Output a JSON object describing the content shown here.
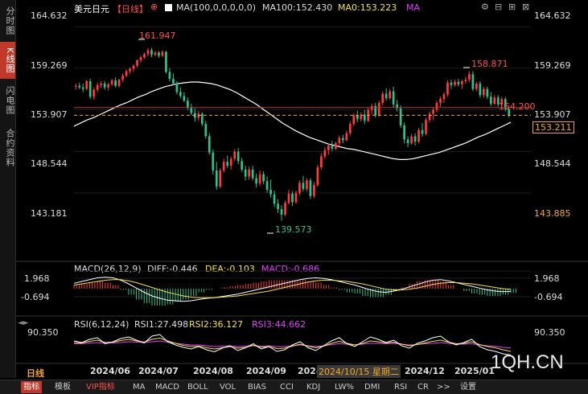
{
  "sidebar": {
    "tabs": [
      {
        "label": "分时图",
        "active": false
      },
      {
        "label": "K线图",
        "active": true
      },
      {
        "label": "闪电图",
        "active": false
      },
      {
        "label": "合约资料",
        "active": false
      }
    ]
  },
  "legend": {
    "symbol": "美元日元",
    "period": "【日线】",
    "ma_prefix": "MA(100,0,0,0,0,0)",
    "ma100": "MA100:152.430",
    "ma0": "MA0:153.223",
    "ma": "MA"
  },
  "toolbar_icons": [
    "gear-icon",
    "minus-icon",
    "plus-icon",
    "close-icon"
  ],
  "price_axis": {
    "ticks": [
      "164.632",
      "159.269",
      "153.907",
      "148.544",
      "143.181"
    ],
    "current_price": "153.211",
    "low_marker": "143.885",
    "high_label": "161.947",
    "low_label": "139.573",
    "recent_high_label": "158.871",
    "ref_label": "154.200"
  },
  "macd": {
    "title": "MACD(26,12,9)",
    "diff": "DIFF:-0.446",
    "dea": "DEA:-0.103",
    "macd": "MACD:-0.686",
    "ticks": [
      "1.968",
      "-0.694"
    ]
  },
  "rsi": {
    "title": "RSI(6,12,24)",
    "rsi1": "RSI1:27.498",
    "rsi2": "RSI2:36.127",
    "rsi3": "RSI3:44.662",
    "ticks": [
      "90.350"
    ]
  },
  "x_axis": {
    "period_label": "日线",
    "dates": [
      "2024/06",
      "2024/07",
      "2024/08",
      "2024/09",
      "2024",
      "2024/12",
      "2025/01"
    ],
    "cursor_label": "2024/10/15 星期二"
  },
  "watermark": "1QH.CN",
  "bottom_tabs": [
    "指标",
    "模板",
    "VIP指标",
    "MA",
    "MACD",
    "BOLL",
    "VOL",
    "BIAS",
    "CCI",
    "KDJ",
    "LW%",
    "DMI",
    "RSI",
    "CR",
    ">>",
    "设置"
  ],
  "colors": {
    "up": "#ff3b3b",
    "down": "#2fc28f",
    "ma": "#ffffff",
    "diff": "#ffffff",
    "dea": "#f5e04a",
    "rsi1": "#ffffff",
    "rsi2": "#f5e04a",
    "rsi3": "#e040fb",
    "accent": "#c0392b"
  },
  "chart_data": {
    "type": "candlestick",
    "ylim": [
      138,
      166
    ],
    "candles": [
      [
        156.9,
        157.3,
        156.5,
        157.0
      ],
      [
        157.0,
        157.4,
        156.6,
        156.8
      ],
      [
        156.8,
        157.3,
        156.2,
        156.6
      ],
      [
        156.6,
        157.8,
        156.4,
        157.6
      ],
      [
        157.6,
        157.9,
        155.3,
        155.6
      ],
      [
        155.6,
        156.8,
        155.2,
        156.5
      ],
      [
        156.5,
        157.4,
        156.2,
        157.1
      ],
      [
        157.1,
        157.6,
        156.7,
        157.3
      ],
      [
        157.3,
        157.6,
        156.5,
        156.8
      ],
      [
        156.8,
        157.4,
        156.4,
        157.2
      ],
      [
        157.2,
        157.9,
        157.0,
        157.7
      ],
      [
        157.7,
        158.1,
        156.8,
        157.0
      ],
      [
        157.0,
        157.9,
        156.8,
        157.8
      ],
      [
        157.8,
        158.6,
        157.5,
        158.3
      ],
      [
        158.3,
        159.1,
        158.1,
        158.9
      ],
      [
        158.9,
        159.4,
        158.6,
        159.2
      ],
      [
        159.2,
        159.8,
        158.8,
        159.6
      ],
      [
        159.6,
        160.4,
        159.4,
        160.3
      ],
      [
        160.3,
        160.9,
        160.0,
        160.7
      ],
      [
        160.7,
        161.3,
        160.5,
        161.1
      ],
      [
        161.1,
        161.9,
        160.8,
        161.6
      ],
      [
        161.6,
        161.9,
        160.7,
        161.0
      ],
      [
        161.0,
        161.5,
        160.8,
        161.3
      ],
      [
        161.3,
        161.5,
        160.6,
        160.9
      ],
      [
        160.9,
        161.6,
        160.7,
        161.4
      ],
      [
        161.4,
        161.5,
        158.6,
        158.8
      ],
      [
        158.8,
        159.3,
        157.6,
        157.9
      ],
      [
        157.9,
        158.6,
        157.1,
        157.3
      ],
      [
        157.3,
        157.6,
        155.9,
        156.2
      ],
      [
        156.2,
        156.8,
        155.4,
        155.7
      ],
      [
        155.7,
        156.2,
        154.9,
        155.1
      ],
      [
        155.1,
        155.5,
        153.9,
        154.2
      ],
      [
        154.2,
        154.7,
        153.2,
        153.5
      ],
      [
        153.5,
        154.1,
        152.4,
        152.9
      ],
      [
        152.9,
        153.8,
        152.5,
        153.4
      ],
      [
        153.4,
        153.6,
        151.8,
        152.1
      ],
      [
        152.1,
        152.5,
        150.2,
        150.5
      ],
      [
        150.5,
        150.9,
        148.1,
        148.4
      ],
      [
        148.4,
        148.8,
        145.6,
        146.1
      ],
      [
        146.1,
        147.2,
        143.6,
        144.0
      ],
      [
        144.0,
        146.4,
        143.8,
        146.1
      ],
      [
        146.1,
        147.6,
        145.8,
        147.2
      ],
      [
        147.2,
        148.0,
        146.4,
        146.7
      ],
      [
        146.7,
        147.9,
        146.2,
        147.6
      ],
      [
        147.6,
        148.8,
        147.3,
        148.5
      ],
      [
        148.5,
        149.0,
        146.9,
        147.3
      ],
      [
        147.3,
        147.7,
        145.9,
        146.2
      ],
      [
        146.2,
        146.7,
        144.8,
        145.3
      ],
      [
        145.3,
        146.6,
        144.9,
        146.2
      ],
      [
        146.2,
        146.7,
        144.8,
        145.1
      ],
      [
        145.1,
        145.7,
        143.9,
        144.4
      ],
      [
        144.4,
        146.1,
        144.1,
        145.6
      ],
      [
        145.6,
        146.0,
        144.3,
        144.7
      ],
      [
        144.7,
        145.3,
        143.2,
        143.6
      ],
      [
        143.6,
        144.9,
        142.6,
        143.0
      ],
      [
        143.0,
        143.5,
        141.4,
        141.8
      ],
      [
        141.8,
        142.4,
        140.6,
        141.1
      ],
      [
        141.1,
        141.6,
        139.6,
        140.4
      ],
      [
        140.4,
        142.2,
        140.2,
        141.9
      ],
      [
        141.9,
        143.6,
        141.7,
        143.1
      ],
      [
        143.1,
        143.4,
        141.5,
        142.0
      ],
      [
        142.0,
        143.5,
        141.8,
        143.2
      ],
      [
        143.2,
        144.8,
        142.9,
        144.5
      ],
      [
        144.5,
        145.4,
        143.4,
        143.7
      ],
      [
        143.7,
        145.1,
        143.4,
        144.8
      ],
      [
        144.8,
        145.1,
        142.4,
        142.8
      ],
      [
        142.8,
        144.6,
        142.5,
        144.2
      ],
      [
        144.2,
        146.8,
        144.0,
        146.5
      ],
      [
        146.5,
        148.3,
        146.2,
        147.9
      ],
      [
        147.9,
        149.1,
        147.6,
        148.7
      ],
      [
        148.7,
        149.6,
        148.1,
        149.3
      ],
      [
        149.3,
        149.9,
        148.6,
        148.9
      ],
      [
        148.9,
        149.8,
        148.7,
        149.6
      ],
      [
        149.6,
        150.6,
        149.3,
        150.3
      ],
      [
        150.3,
        150.7,
        149.6,
        150.0
      ],
      [
        150.0,
        151.2,
        149.8,
        150.9
      ],
      [
        150.9,
        152.4,
        150.6,
        152.1
      ],
      [
        152.1,
        153.5,
        151.8,
        153.2
      ],
      [
        153.2,
        153.8,
        152.3,
        152.7
      ],
      [
        152.7,
        153.6,
        152.4,
        153.3
      ],
      [
        153.3,
        153.9,
        152.1,
        152.5
      ],
      [
        152.5,
        154.2,
        152.3,
        153.9
      ],
      [
        153.9,
        154.7,
        153.3,
        154.4
      ],
      [
        154.4,
        154.8,
        152.9,
        153.2
      ],
      [
        153.2,
        155.1,
        153.0,
        154.8
      ],
      [
        154.8,
        156.3,
        154.5,
        156.0
      ],
      [
        156.0,
        156.7,
        155.1,
        155.4
      ],
      [
        155.4,
        156.6,
        155.2,
        156.3
      ],
      [
        156.3,
        156.9,
        154.2,
        154.6
      ],
      [
        154.6,
        155.2,
        153.7,
        154.1
      ],
      [
        154.1,
        154.5,
        151.6,
        151.9
      ],
      [
        151.9,
        152.3,
        149.6,
        150.1
      ],
      [
        150.1,
        150.5,
        149.1,
        149.6
      ],
      [
        149.6,
        150.8,
        149.4,
        150.5
      ],
      [
        150.5,
        150.9,
        149.3,
        149.8
      ],
      [
        149.8,
        151.6,
        149.6,
        151.3
      ],
      [
        151.3,
        152.2,
        150.4,
        150.8
      ],
      [
        150.8,
        152.9,
        150.6,
        152.6
      ],
      [
        152.6,
        153.7,
        152.3,
        153.4
      ],
      [
        153.4,
        154.2,
        152.6,
        153.9
      ],
      [
        153.9,
        155.1,
        153.6,
        154.8
      ],
      [
        154.8,
        155.6,
        154.3,
        155.3
      ],
      [
        155.3,
        156.2,
        154.8,
        155.9
      ],
      [
        155.9,
        157.7,
        155.6,
        157.4
      ],
      [
        157.4,
        157.8,
        156.6,
        157.1
      ],
      [
        157.1,
        157.8,
        156.9,
        157.5
      ],
      [
        157.5,
        157.9,
        156.9,
        157.2
      ],
      [
        157.2,
        157.8,
        156.6,
        157.6
      ],
      [
        157.6,
        158.2,
        157.3,
        157.8
      ],
      [
        157.8,
        158.9,
        157.5,
        158.5
      ],
      [
        158.5,
        158.9,
        156.3,
        156.6
      ],
      [
        156.6,
        157.5,
        156.3,
        157.3
      ],
      [
        157.3,
        157.6,
        155.5,
        155.8
      ],
      [
        155.8,
        156.9,
        155.5,
        156.6
      ],
      [
        156.6,
        156.9,
        155.3,
        155.6
      ],
      [
        155.6,
        156.2,
        154.4,
        154.7
      ],
      [
        154.7,
        155.8,
        154.5,
        155.5
      ],
      [
        155.5,
        155.8,
        154.3,
        154.6
      ],
      [
        154.6,
        155.6,
        154.2,
        155.3
      ],
      [
        155.3,
        155.6,
        153.7,
        154.0
      ],
      [
        154.0,
        154.3,
        152.9,
        153.2
      ]
    ],
    "ma100": [
      151.8,
      152.2,
      152.6,
      152.9,
      153.3,
      153.7,
      154.1,
      154.5,
      154.8,
      155.2,
      155.6,
      155.9,
      156.3,
      156.6,
      156.9,
      157.1,
      157.3,
      157.4,
      157.5,
      157.5,
      157.4,
      157.3,
      157.1,
      156.8,
      156.5,
      156.1,
      155.6,
      155.1,
      154.6,
      154.0,
      153.4,
      152.8,
      152.2,
      151.7,
      151.2,
      150.8,
      150.4,
      150.1,
      149.8,
      149.5,
      149.3,
      149.1,
      148.9,
      148.8,
      148.6,
      148.4,
      148.2,
      148.0,
      147.8,
      147.6,
      147.5,
      147.5,
      147.6,
      147.8,
      148.0,
      148.2,
      148.4,
      148.7,
      149.0,
      149.3,
      149.6,
      150.0,
      150.4,
      150.7,
      151.1,
      151.5,
      151.9,
      152.3
    ],
    "ma100_start_index": 0,
    "series": [
      {
        "name": "DIFF",
        "values": [
          0.9,
          1.2,
          1.5,
          1.8,
          1.9,
          1.8,
          1.4,
          0.8,
          0.1,
          -0.6,
          -1.2,
          -1.6,
          -1.9,
          -2.0,
          -2.1,
          -2.0,
          -1.8,
          -1.6,
          -1.5,
          -1.3,
          -1.1,
          -0.9,
          -0.6,
          -0.3,
          0.0,
          0.3,
          0.6,
          0.9,
          1.2,
          1.5,
          1.7,
          1.8,
          1.7,
          1.5,
          1.2,
          0.9,
          0.6,
          0.2,
          -0.2,
          -0.5,
          -0.6,
          -0.4,
          -0.1,
          0.3,
          0.7,
          1.1,
          1.4,
          1.5,
          1.3,
          1.0,
          0.7,
          0.4,
          0.1,
          -0.2,
          -0.4,
          -0.5,
          -0.45
        ]
      },
      {
        "name": "DEA",
        "values": [
          0.6,
          0.8,
          1.0,
          1.2,
          1.4,
          1.5,
          1.5,
          1.3,
          1.0,
          0.6,
          0.2,
          -0.2,
          -0.6,
          -0.9,
          -1.2,
          -1.4,
          -1.5,
          -1.5,
          -1.5,
          -1.4,
          -1.3,
          -1.2,
          -1.0,
          -0.8,
          -0.6,
          -0.4,
          -0.1,
          0.2,
          0.5,
          0.8,
          1.1,
          1.3,
          1.4,
          1.4,
          1.3,
          1.2,
          1.0,
          0.8,
          0.5,
          0.2,
          -0.1,
          -0.2,
          -0.2,
          -0.1,
          0.1,
          0.4,
          0.7,
          0.9,
          1.0,
          1.0,
          0.9,
          0.8,
          0.6,
          0.4,
          0.2,
          0.0,
          -0.1
        ]
      }
    ],
    "rsi_series": [
      {
        "name": "RSI1",
        "values": [
          62,
          58,
          66,
          70,
          55,
          60,
          68,
          72,
          64,
          57,
          74,
          78,
          60,
          52,
          46,
          42,
          48,
          40,
          35,
          44,
          50,
          38,
          45,
          55,
          42,
          48,
          36,
          40,
          52,
          60,
          45,
          38,
          50,
          62,
          70,
          55,
          48,
          60,
          72,
          66,
          58,
          64,
          50,
          44,
          56,
          62,
          70,
          74,
          60,
          52,
          58,
          66,
          48,
          40,
          36,
          30,
          27
        ]
      },
      {
        "name": "RSI2",
        "values": [
          58,
          57,
          61,
          64,
          58,
          59,
          63,
          66,
          62,
          59,
          66,
          69,
          62,
          56,
          51,
          48,
          49,
          45,
          42,
          45,
          48,
          44,
          46,
          51,
          46,
          48,
          43,
          44,
          49,
          54,
          49,
          45,
          49,
          56,
          61,
          56,
          52,
          56,
          62,
          60,
          57,
          59,
          54,
          50,
          53,
          57,
          61,
          64,
          59,
          55,
          56,
          60,
          53,
          48,
          45,
          40,
          36
        ]
      },
      {
        "name": "RSI3",
        "values": [
          55,
          55,
          57,
          58,
          56,
          57,
          58,
          60,
          59,
          58,
          60,
          62,
          59,
          56,
          54,
          52,
          52,
          50,
          48,
          49,
          50,
          48,
          49,
          51,
          49,
          50,
          48,
          48,
          50,
          52,
          50,
          48,
          50,
          53,
          55,
          54,
          52,
          54,
          56,
          56,
          55,
          56,
          54,
          52,
          53,
          55,
          56,
          58,
          56,
          54,
          54,
          55,
          52,
          50,
          49,
          46,
          45
        ]
      }
    ]
  }
}
